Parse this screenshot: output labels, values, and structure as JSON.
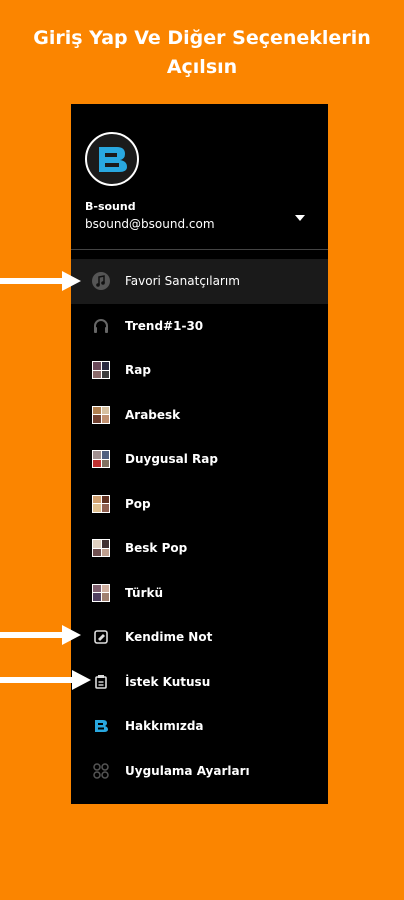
{
  "headline": {
    "line1": "Giriş Yap Ve Diğer Seçeneklerin",
    "line2": "Açılsın"
  },
  "profile": {
    "logo_icon": "bsound-logo-icon",
    "name": "B-sound",
    "email": "bsound@bsound.com",
    "dropdown_icon": "caret-down-icon"
  },
  "menu": [
    {
      "label": "Favori Sanatçılarım",
      "icon": "music-note-icon"
    },
    {
      "label": "Trend#1-30",
      "icon": "headphones-icon"
    },
    {
      "label": "Rap",
      "icon": "album-thumb-icon"
    },
    {
      "label": "Arabesk",
      "icon": "album-thumb-icon"
    },
    {
      "label": "Duygusal Rap",
      "icon": "album-thumb-icon"
    },
    {
      "label": "Pop",
      "icon": "album-thumb-icon"
    },
    {
      "label": "Besk Pop",
      "icon": "album-thumb-icon"
    },
    {
      "label": "Türkü",
      "icon": "album-thumb-icon"
    },
    {
      "label": "Kendime Not",
      "icon": "note-icon"
    },
    {
      "label": "İstek Kutusu",
      "icon": "request-box-icon"
    },
    {
      "label": "Hakkımızda",
      "icon": "bsound-logo-icon"
    },
    {
      "label": "Uygulama Ayarları",
      "icon": "grid-settings-icon"
    }
  ],
  "colors": {
    "background": "#FB8500",
    "drawer": "#000000",
    "accent": "#29A8E0"
  }
}
